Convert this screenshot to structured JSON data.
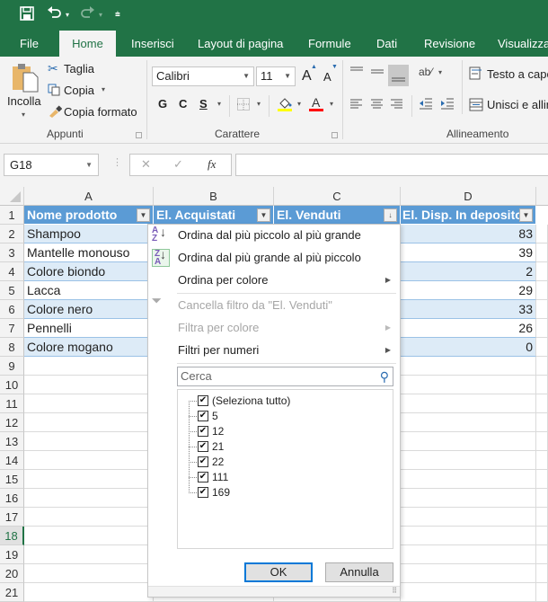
{
  "quick_access": {
    "save_icon": "save-icon",
    "undo_icon": "undo-icon",
    "redo_icon": "redo-icon",
    "customize_icon": "customize-qat-icon"
  },
  "tabs": [
    {
      "label": "File",
      "active": false
    },
    {
      "label": "Home",
      "active": true
    },
    {
      "label": "Inserisci",
      "active": false
    },
    {
      "label": "Layout di pagina",
      "active": false
    },
    {
      "label": "Formule",
      "active": false
    },
    {
      "label": "Dati",
      "active": false
    },
    {
      "label": "Revisione",
      "active": false
    },
    {
      "label": "Visualizza",
      "active": false
    }
  ],
  "ribbon": {
    "clipboard": {
      "label": "Appunti",
      "paste": "Incolla",
      "cut": "Taglia",
      "copy": "Copia",
      "format_painter": "Copia formato"
    },
    "font": {
      "label": "Carattere",
      "font_name": "Calibri",
      "font_size": "11",
      "bold": "G",
      "italic": "C",
      "underline": "S",
      "grow": "A",
      "shrink": "A",
      "fill_color": "#ffff00",
      "font_color": "#ff0000"
    },
    "alignment": {
      "label": "Allineamento",
      "wrap_text": "Testo a capo",
      "merge": "Unisci e allinea"
    }
  },
  "formula_bar": {
    "name_box": "G18",
    "cancel": "✕",
    "enter": "✓",
    "fx": "fx",
    "value": ""
  },
  "sheet": {
    "columns": [
      "A",
      "B",
      "C",
      "D"
    ],
    "row_numbers": [
      "1",
      "2",
      "3",
      "4",
      "5",
      "6",
      "7",
      "8",
      "9",
      "10",
      "11",
      "12",
      "13",
      "14",
      "15",
      "16",
      "17",
      "18",
      "19",
      "20",
      "21"
    ],
    "selected_row": "18",
    "headers": [
      "Nome prodotto",
      "El. Acquistati",
      "El. Venduti",
      "El. Disp. In deposito"
    ],
    "rows": [
      {
        "name": "Shampoo",
        "stock": "83"
      },
      {
        "name": "Mantelle monouso",
        "stock": "39"
      },
      {
        "name": "Colore biondo",
        "stock": "2"
      },
      {
        "name": "Lacca",
        "stock": "29"
      },
      {
        "name": "Colore nero",
        "stock": "33"
      },
      {
        "name": "Pennelli",
        "stock": "26"
      },
      {
        "name": "Colore mogano",
        "stock": "0"
      }
    ],
    "table_header_color": "#5b9bd5",
    "table_band_color": "#ddebf7"
  },
  "filter_menu": {
    "sort_asc": "Ordina dal più piccolo al più grande",
    "sort_desc": "Ordina dal più grande al più piccolo",
    "sort_color": "Ordina per colore",
    "clear_filter": "Cancella filtro da \"El. Venduti\"",
    "filter_color": "Filtra per colore",
    "number_filters": "Filtri per numeri",
    "search_placeholder": "Cerca",
    "values": [
      {
        "label": "(Seleziona tutto)",
        "checked": true
      },
      {
        "label": "5",
        "checked": true
      },
      {
        "label": "12",
        "checked": true
      },
      {
        "label": "21",
        "checked": true
      },
      {
        "label": "22",
        "checked": true
      },
      {
        "label": "111",
        "checked": true
      },
      {
        "label": "169",
        "checked": true
      }
    ],
    "ok": "OK",
    "cancel": "Annulla"
  }
}
